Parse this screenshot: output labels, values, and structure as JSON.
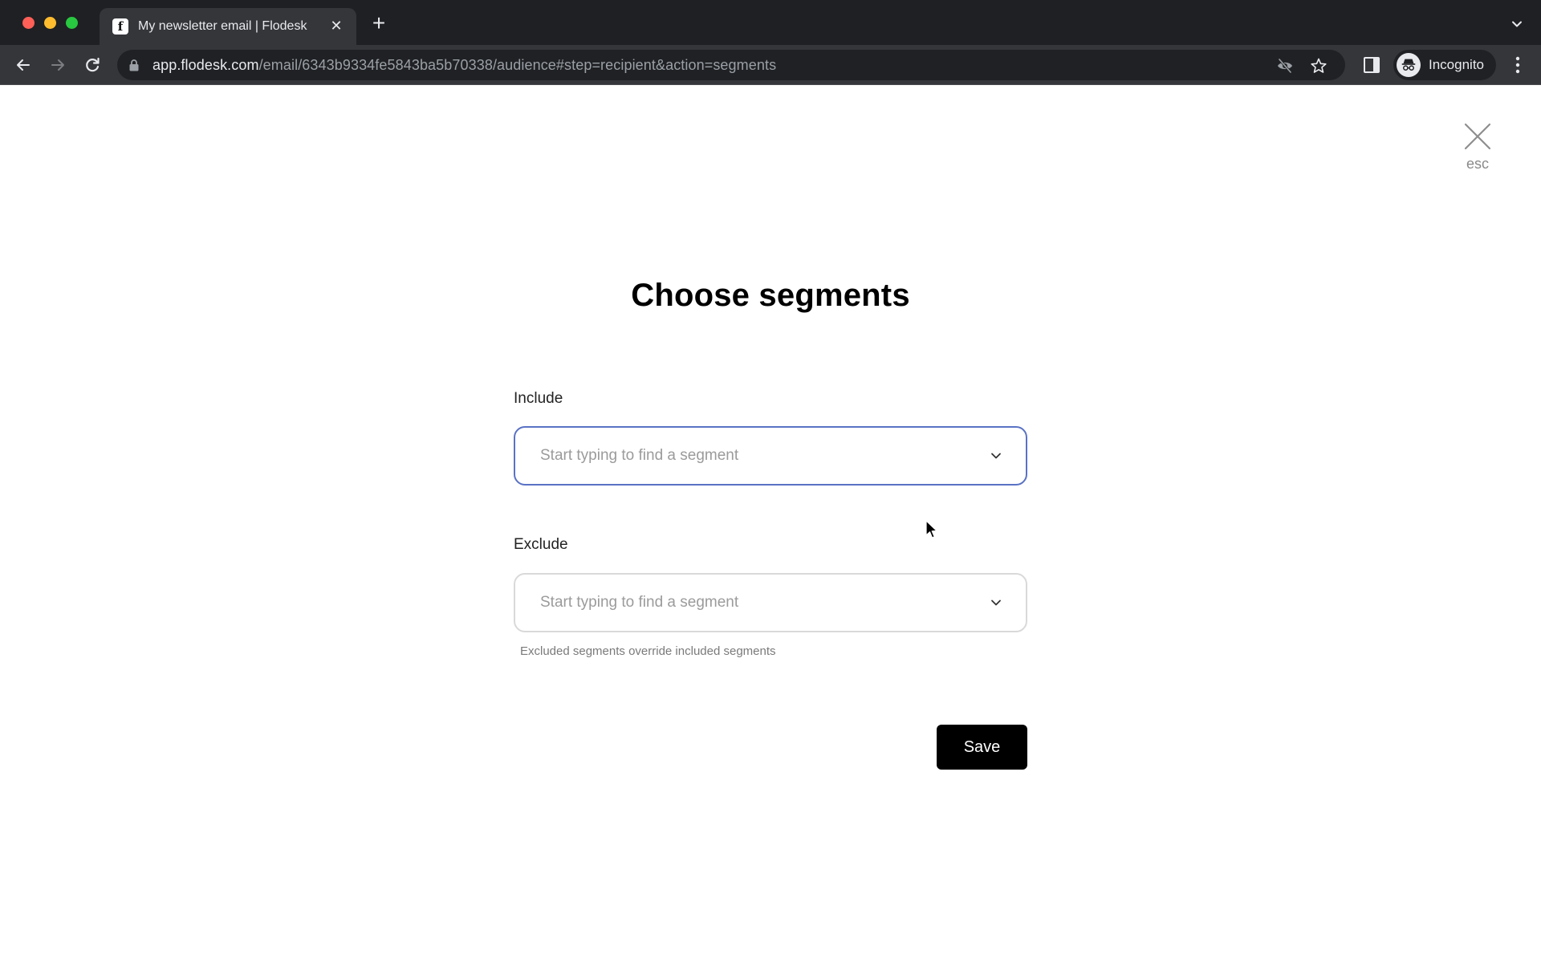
{
  "browser": {
    "tab": {
      "title": "My newsletter email | Flodesk",
      "favicon_glyph": "f",
      "close_glyph": "✕"
    },
    "new_tab_glyph": "+",
    "url": {
      "host": "app.flodesk.com",
      "path": "/email/6343b9334fe5843ba5b70338/audience#step=recipient&action=segments"
    },
    "profile": {
      "label": "Incognito"
    },
    "icons": {
      "back": "arrow-left-icon",
      "forward": "arrow-right-icon",
      "reload": "reload-icon",
      "lock": "lock-icon",
      "tracking": "eye-off-icon",
      "bookmark": "star-icon",
      "side_panel": "side-panel-icon",
      "menu": "more-vert-icon",
      "tab_search": "chevron-down-icon"
    }
  },
  "modal": {
    "close": {
      "hint": "esc"
    },
    "title": "Choose segments",
    "include": {
      "label": "Include",
      "placeholder": "Start typing to find a segment",
      "value": "",
      "focused": true
    },
    "exclude": {
      "label": "Exclude",
      "placeholder": "Start typing to find a segment",
      "value": "",
      "hint": "Excluded segments override included segments"
    },
    "save_label": "Save"
  },
  "colors": {
    "focus_border": "#5a72c4",
    "primary_button": "#000000",
    "chrome_dark": "#1f2023"
  }
}
